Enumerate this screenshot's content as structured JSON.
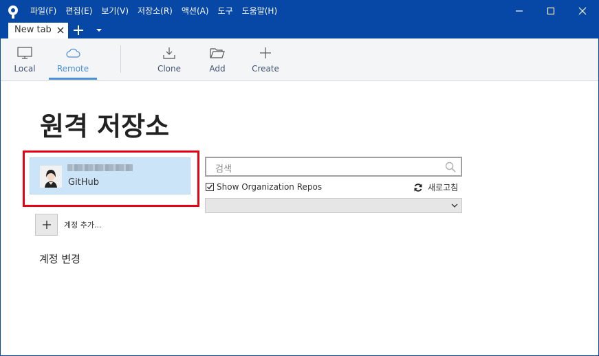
{
  "menu": [
    "파일(F)",
    "편집(E)",
    "보기(V)",
    "저장소(R)",
    "액션(A)",
    "도구",
    "도움말(H)"
  ],
  "tabs": [
    {
      "label": "New tab"
    }
  ],
  "toolbar": {
    "local": "Local",
    "remote": "Remote",
    "clone": "Clone",
    "add": "Add",
    "create": "Create"
  },
  "page": {
    "title": "원격 저장소"
  },
  "account": {
    "provider": "GitHub",
    "add_label": "계정 추가...",
    "change_label": "계정 변경"
  },
  "search": {
    "placeholder": "검색"
  },
  "org": {
    "label": "Show Organization Repos",
    "checked": true
  },
  "refresh": {
    "label": "새로고침"
  },
  "colors": {
    "titlebar": "#0747a6",
    "accent": "#4a8ed6",
    "highlight": "#e60012",
    "card": "#cce4f7"
  }
}
